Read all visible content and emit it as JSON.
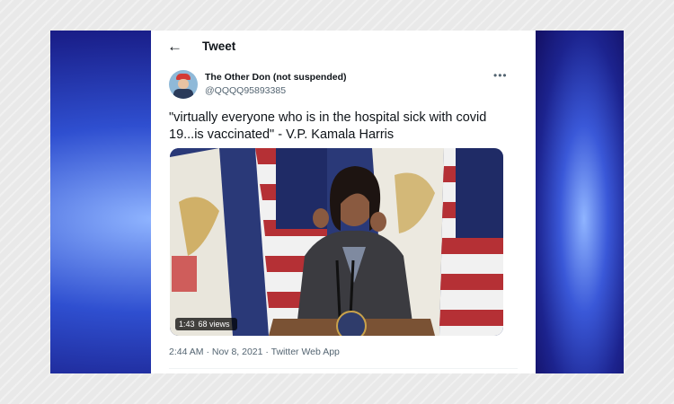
{
  "header": {
    "title": "Tweet",
    "back_icon": "arrow-left-icon"
  },
  "author": {
    "name": "The Other Don (not suspended)",
    "handle": "@QQQQ95893385",
    "avatar_icon": "avatar"
  },
  "more_icon": "ellipsis-icon",
  "tweet": {
    "text": "\"virtually everyone who is in the hospital sick with covid 19...is vaccinated\" - V.P. Kamala Harris",
    "timestamp": "2:44 AM · Nov 8, 2021 · Twitter Web App"
  },
  "video": {
    "duration": "1:43",
    "views": "68 views"
  },
  "colors": {
    "text_primary": "#0f1419",
    "text_secondary": "#536471",
    "frame_blue": "#2f4fd0"
  }
}
